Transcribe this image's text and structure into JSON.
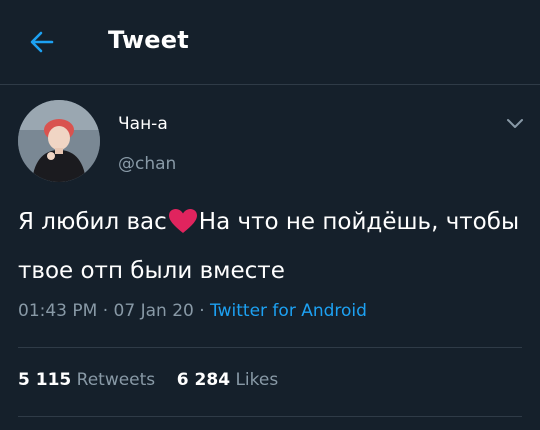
{
  "header": {
    "title": "Tweet"
  },
  "tweet": {
    "author_name": "Чан-а",
    "handle": "@chan",
    "text_part1": "Я любил вас",
    "text_part2": "На что не пойдёшь, чтобы твое отп были вместе",
    "time": "01:43 PM",
    "date": "07 Jan 20",
    "separator": "·",
    "source": "Twitter for Android",
    "retweets_count": "5 115",
    "retweets_label": "Retweets",
    "likes_count": "6 284",
    "likes_label": "Likes"
  },
  "colors": {
    "background": "#15202b",
    "accent": "#1da1f2",
    "secondary_text": "#8899a6",
    "heart": "#e0245e"
  },
  "icons": {
    "back": "arrow-left-icon",
    "menu": "chevron-down-icon",
    "emoji": "red-heart-icon"
  }
}
